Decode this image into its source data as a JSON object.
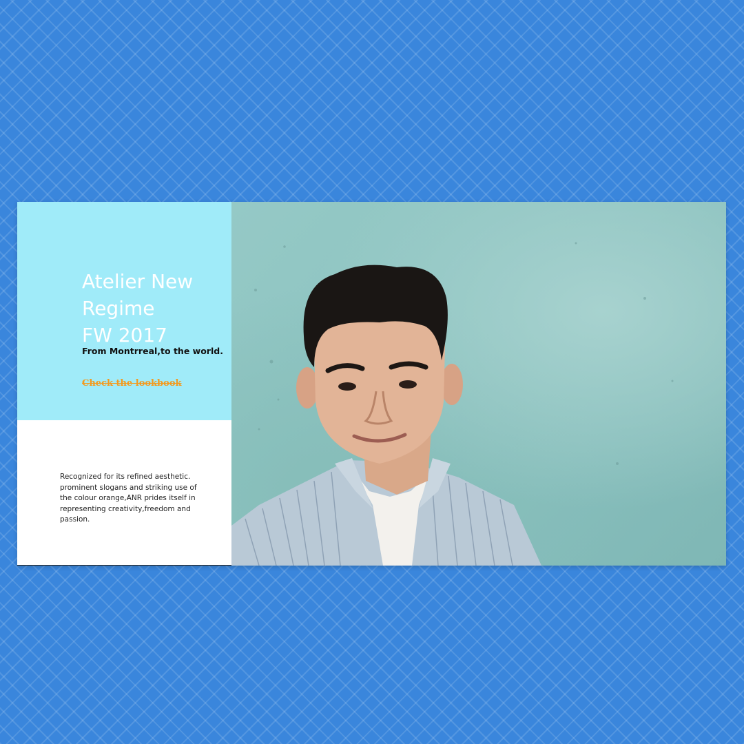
{
  "hero": {
    "title_lines": [
      "Atelier New",
      "Regime",
      "FW 2017"
    ],
    "subtitle": "From Montrreal,to the world.",
    "cta_label": "Check the lookbook"
  },
  "description": "Recognized for its refined aesthetic. prominent slogans and striking use of the colour orange,ANR prides itself in representing creativity,freedom and passion.",
  "colors": {
    "page_background": "#3a86dc",
    "hero_panel": "#a0ebf9",
    "accent": "#f39a1f",
    "photo_wall": "#8fc6c3"
  }
}
